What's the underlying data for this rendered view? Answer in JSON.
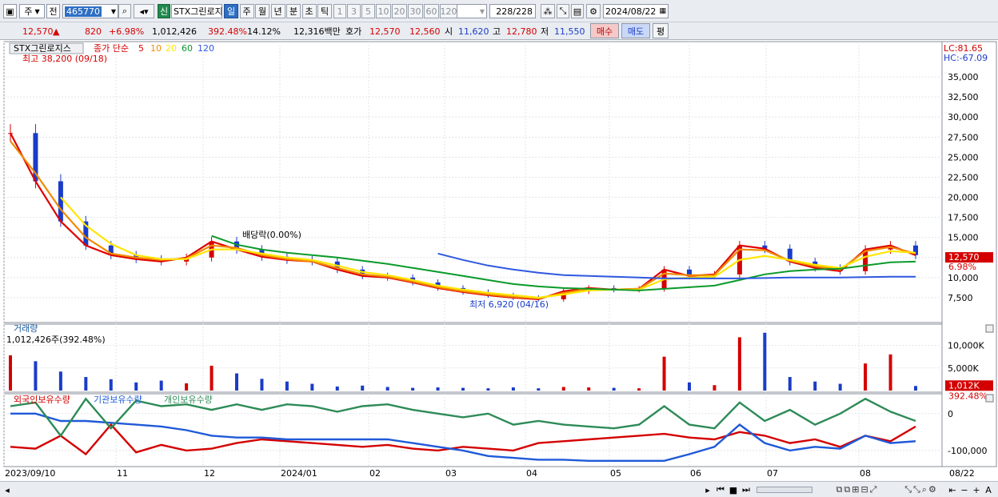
{
  "toolbar": {
    "period_select": "주",
    "mode_select": "전",
    "code": "465770",
    "new_label": "신",
    "stock_name": "STX그린로지",
    "periods": [
      "일",
      "주",
      "월",
      "년",
      "분",
      "초",
      "틱"
    ],
    "active_period": "일",
    "ticks": [
      "1",
      "3",
      "5",
      "10",
      "20",
      "30",
      "60",
      "120"
    ],
    "count": "228/228",
    "date": "2024/08/22"
  },
  "quote": {
    "price": "12,570",
    "arrow": "▲",
    "change": "820",
    "change_pct": "+6.98%",
    "volume": "1,012,426",
    "vol_ratio": "392.48%",
    "turnover": "14.12%",
    "amount": "12,316백만",
    "hoga_label": "호가",
    "ask": "12,570",
    "bid": "12,560",
    "open_label": "시",
    "open": "11,620",
    "high_label": "고",
    "high": "12,780",
    "low_label": "저",
    "low": "11,550",
    "buy_label": "매수",
    "sell_label": "매도",
    "eval_label": "평"
  },
  "price_panel": {
    "title": "STX그린로지스",
    "ma_label": "종가 단순",
    "ma_periods": [
      "5",
      "10",
      "20",
      "60",
      "120"
    ],
    "max_note": "최고 38,200 (09/18)",
    "min_note": "최저 6,920 (04/16)",
    "dividend_note": "배당락(0.00%)",
    "lc": "LC:81.65",
    "hc": "HC:-67.09",
    "last_tag": "12,570",
    "last_pct": "6.98%",
    "yaxis": [
      "35,000",
      "32,500",
      "30,000",
      "27,500",
      "25,000",
      "22,500",
      "20,000",
      "17,500",
      "15,000",
      "12,500",
      "10,000",
      "7,500"
    ]
  },
  "volume_panel": {
    "title": "거래량",
    "value": "1,012,426주(392.48%)",
    "yaxis": [
      "10,000K",
      "5,000K"
    ],
    "tag": "1,012K",
    "tag_pct": "392.48%"
  },
  "holder_panel": {
    "labels": [
      "외국인보유수량",
      "기관보유수량",
      "개인보유수량"
    ],
    "yaxis": [
      "0",
      "-100,000"
    ]
  },
  "xaxis": [
    "2023/09/10",
    "11",
    "12",
    "2024/01",
    "02",
    "03",
    "04",
    "05",
    "06",
    "07",
    "08",
    "08/22"
  ],
  "colors": {
    "up": "#d40000",
    "down": "#1a3cc8",
    "ma5": "#e00000",
    "ma10": "#f08a00",
    "ma20": "#ffe600",
    "ma60": "#0a9a2a",
    "ma120": "#2f58e0",
    "foreign": "#d40000",
    "inst": "#1f5ad8",
    "retail": "#2e8b57"
  },
  "chart_data": [
    {
      "type": "candlestick",
      "title": "STX그린로지스",
      "series": [
        {
          "name": "5",
          "values": [
            28000,
            22000,
            17000,
            14000,
            12800,
            12300,
            12000,
            12500,
            14500,
            13500,
            12600,
            12200,
            12000,
            11000,
            10200,
            10000,
            9400,
            8700,
            8200,
            7800,
            7500,
            7300,
            8300,
            8700,
            8500,
            8600,
            11000,
            10200,
            10400,
            14000,
            13600,
            12000,
            11200,
            10800,
            13500,
            14000,
            12800
          ]
        },
        {
          "name": "10",
          "values": [
            27000,
            23000,
            18500,
            15000,
            13000,
            12500,
            12200,
            12400,
            14000,
            13700,
            12800,
            12300,
            12000,
            11200,
            10400,
            10100,
            9500,
            8800,
            8300,
            7900,
            7600,
            7400,
            8100,
            8600,
            8500,
            8600,
            10500,
            10300,
            10300,
            13500,
            13400,
            12100,
            11400,
            11000,
            13300,
            13800,
            13000
          ]
        },
        {
          "name": "20",
          "values": [
            null,
            null,
            20000,
            16500,
            14200,
            12800,
            12300,
            12300,
            13500,
            13500,
            13000,
            12500,
            12200,
            11500,
            10700,
            10300,
            9700,
            9000,
            8500,
            8100,
            7800,
            7500,
            7900,
            8400,
            8500,
            8500,
            9800,
            10000,
            10100,
            12200,
            12700,
            12200,
            11600,
            11200,
            12600,
            13300,
            13100
          ]
        },
        {
          "name": "60",
          "values": [
            null,
            null,
            null,
            null,
            null,
            null,
            null,
            null,
            15200,
            14100,
            13500,
            13100,
            12800,
            12500,
            12100,
            11700,
            11200,
            10700,
            10200,
            9700,
            9200,
            8900,
            8700,
            8600,
            8500,
            8400,
            8600,
            8800,
            9000,
            9700,
            10400,
            10800,
            11000,
            11100,
            11500,
            11900,
            12000
          ]
        },
        {
          "name": "120",
          "values": [
            null,
            null,
            null,
            null,
            null,
            null,
            null,
            null,
            null,
            null,
            null,
            null,
            null,
            null,
            null,
            null,
            null,
            13000,
            12200,
            11500,
            11000,
            10600,
            10300,
            10200,
            10100,
            10000,
            9900,
            9900,
            9900,
            9900,
            9950,
            10000,
            10000,
            10000,
            10050,
            10100,
            10100
          ]
        }
      ],
      "ylim": [
        5000,
        38200
      ],
      "max": {
        "value": 38200,
        "date": "09/18"
      },
      "min": {
        "value": 6920,
        "date": "04/16"
      },
      "last": 12570
    },
    {
      "type": "bar",
      "title": "거래량",
      "unit": "K",
      "values": [
        7800,
        6500,
        4200,
        3000,
        2500,
        1800,
        2200,
        1600,
        5500,
        3800,
        2600,
        2000,
        1500,
        900,
        1100,
        800,
        600,
        700,
        600,
        500,
        700,
        500,
        800,
        700,
        600,
        500,
        7500,
        1800,
        1200,
        11800,
        12800,
        3000,
        2000,
        1500,
        6000,
        8000,
        1012
      ],
      "ylim": [
        0,
        14000
      ]
    },
    {
      "type": "line",
      "title": "보유수량",
      "series": [
        {
          "name": "외국인보유수량",
          "values": [
            -90000,
            -95000,
            -60000,
            -110000,
            -30000,
            -105000,
            -85000,
            -100000,
            -95000,
            -80000,
            -70000,
            -75000,
            -80000,
            -85000,
            -90000,
            -85000,
            -95000,
            -100000,
            -90000,
            -95000,
            -100000,
            -80000,
            -75000,
            -70000,
            -65000,
            -60000,
            -55000,
            -65000,
            -70000,
            -50000,
            -60000,
            -80000,
            -70000,
            -90000,
            -60000,
            -75000,
            -35000
          ]
        },
        {
          "name": "기관보유수량",
          "values": [
            0,
            0,
            -20000,
            -20000,
            -25000,
            -30000,
            -35000,
            -45000,
            -60000,
            -65000,
            -65000,
            -70000,
            -70000,
            -70000,
            -70000,
            -70000,
            -80000,
            -90000,
            -100000,
            -115000,
            -120000,
            -125000,
            -125000,
            -128000,
            -128000,
            -128000,
            -128000,
            -110000,
            -90000,
            -30000,
            -80000,
            -100000,
            -90000,
            -95000,
            -60000,
            -80000,
            -75000
          ]
        },
        {
          "name": "개인보유수량",
          "values": [
            20000,
            30000,
            -60000,
            40000,
            -40000,
            35000,
            20000,
            25000,
            10000,
            25000,
            10000,
            25000,
            20000,
            5000,
            20000,
            25000,
            10000,
            0,
            -10000,
            0,
            -30000,
            -20000,
            -30000,
            -35000,
            -40000,
            -30000,
            20000,
            -30000,
            -40000,
            30000,
            -20000,
            10000,
            -30000,
            0,
            40000,
            5000,
            -20000
          ]
        }
      ],
      "ylim": [
        -135000,
        45000
      ]
    }
  ]
}
